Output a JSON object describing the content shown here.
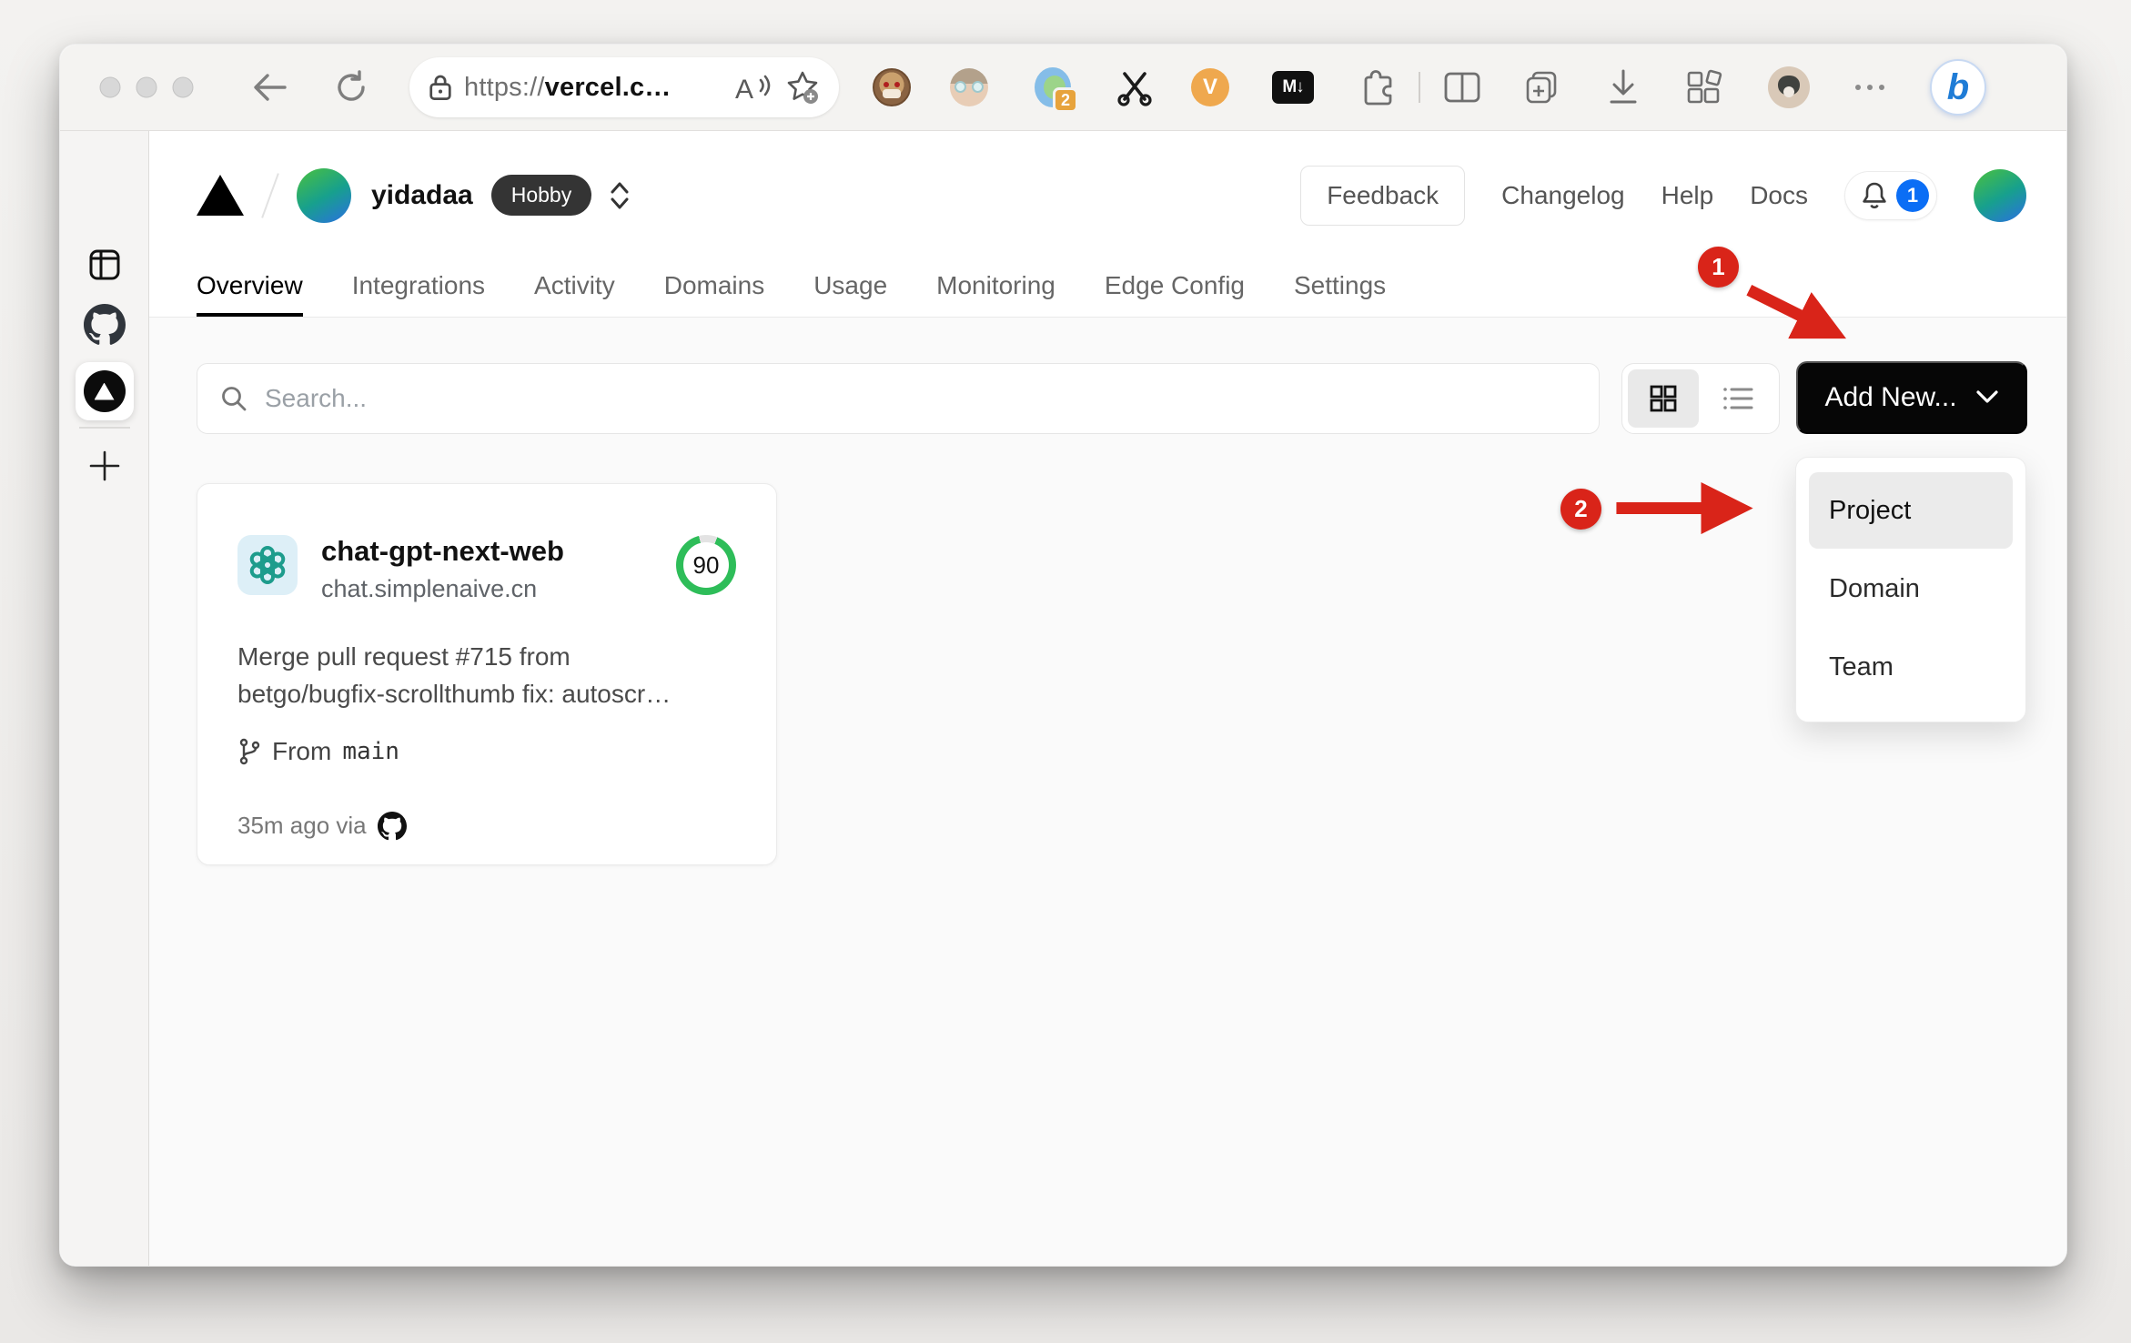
{
  "colors": {
    "red": "#d92419",
    "blue": "#0b6ef5",
    "green": "#2ebd59",
    "teal": "#1d9c8c",
    "toolbarBg": "#f4f3f1",
    "pageBg": "#fafafa"
  },
  "browser": {
    "url_prefix": "https://",
    "url_domain": "vercel.c…",
    "extension_badge": "2",
    "v_extension_label": "V",
    "markdown_extension_label": "M↓",
    "bing_label": "b",
    "toolbar_icon_names": [
      "back-icon",
      "reload-icon",
      "lock-icon",
      "read-aloud-icon",
      "favorite-star-icon",
      "monkey-extension-icon",
      "person-extension-icon",
      "tab-manager-extension-icon",
      "scissors-extension-icon",
      "v-extension-icon",
      "markdown-extension-icon",
      "extensions-puzzle-icon",
      "split-screen-icon",
      "collections-icon",
      "downloads-icon",
      "apps-icon",
      "profile-avatar",
      "more-menu-icon",
      "bing-discover-icon"
    ]
  },
  "sidebar": {
    "icon_names": [
      "tab-panel-icon",
      "github-tab-icon",
      "vercel-active-tab-icon",
      "new-tab-plus-icon"
    ]
  },
  "header": {
    "team_name": "yidadaa",
    "plan_badge": "Hobby",
    "actions": {
      "feedback": "Feedback",
      "changelog": "Changelog",
      "help": "Help",
      "docs": "Docs"
    },
    "notification_count": "1",
    "tabs": [
      "Overview",
      "Integrations",
      "Activity",
      "Domains",
      "Usage",
      "Monitoring",
      "Edge Config",
      "Settings"
    ],
    "active_tab": "Overview"
  },
  "controls": {
    "search_placeholder": "Search...",
    "add_new": "Add New..."
  },
  "project": {
    "name": "chat-gpt-next-web",
    "domain": "chat.simplenaive.cn",
    "score": "90",
    "commit_line1": "Merge pull request #715 from",
    "commit_line2": "betgo/bugfix-scrollthumb fix: autoscr…",
    "branch_label": "From",
    "branch_name": "main",
    "deployed": "35m ago via"
  },
  "dropdown": {
    "items": [
      "Project",
      "Domain",
      "Team"
    ],
    "highlighted": "Project"
  },
  "annotations": {
    "step1": "1",
    "step2": "2"
  }
}
